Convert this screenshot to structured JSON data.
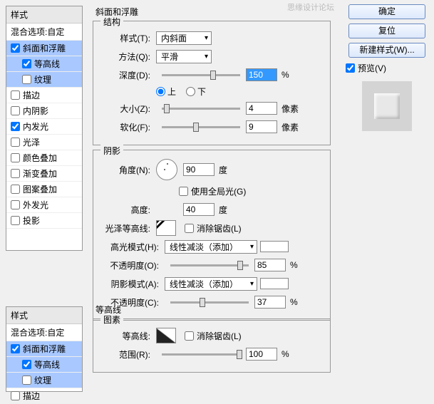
{
  "watermark": "思缘设计论坛",
  "styles_panel": {
    "header": "样式",
    "blend": "混合选项:自定",
    "items": [
      {
        "label": "斜面和浮雕",
        "checked": true,
        "selected": true
      },
      {
        "label": "等高线",
        "checked": true,
        "sub": true,
        "selected": true
      },
      {
        "label": "纹理",
        "checked": false,
        "sub": true,
        "selected": true
      },
      {
        "label": "描边",
        "checked": false
      },
      {
        "label": "内阴影",
        "checked": false
      },
      {
        "label": "内发光",
        "checked": true
      },
      {
        "label": "光泽",
        "checked": false
      },
      {
        "label": "颜色叠加",
        "checked": false
      },
      {
        "label": "渐变叠加",
        "checked": false
      },
      {
        "label": "图案叠加",
        "checked": false
      },
      {
        "label": "外发光",
        "checked": false
      },
      {
        "label": "投影",
        "checked": false
      }
    ]
  },
  "bottom_styles": {
    "header": "样式",
    "blend": "混合选项:自定",
    "items": [
      {
        "label": "斜面和浮雕",
        "checked": true,
        "selected": true
      },
      {
        "label": "等高线",
        "checked": true,
        "sub": true,
        "selected": true
      },
      {
        "label": "纹理",
        "checked": false,
        "sub": true,
        "selected": true
      },
      {
        "label": "描边",
        "checked": false
      }
    ]
  },
  "bevel": {
    "title": "斜面和浮雕",
    "structure_label": "结构",
    "style_label": "样式(T):",
    "style_value": "内斜面",
    "method_label": "方法(Q):",
    "method_value": "平滑",
    "depth_label": "深度(D):",
    "depth_value": "150",
    "depth_unit": "%",
    "direction_up": "上",
    "direction_down": "下",
    "size_label": "大小(Z):",
    "size_value": "4",
    "size_unit": "像素",
    "soften_label": "软化(F):",
    "soften_value": "9",
    "soften_unit": "像素"
  },
  "shadow": {
    "label": "阴影",
    "angle_label": "角度(N):",
    "angle_value": "90",
    "angle_unit": "度",
    "global_label": "使用全局光(G)",
    "altitude_label": "高度:",
    "altitude_value": "40",
    "altitude_unit": "度",
    "gloss_label": "光泽等高线:",
    "antialias_label": "消除锯齿(L)",
    "highlight_mode_label": "高光模式(H):",
    "highlight_mode_value": "线性减淡（添加）",
    "highlight_opacity_label": "不透明度(O):",
    "highlight_opacity_value": "85",
    "highlight_opacity_unit": "%",
    "shadow_mode_label": "阴影模式(A):",
    "shadow_mode_value": "线性减淡（添加）",
    "shadow_opacity_label": "不透明度(C):",
    "shadow_opacity_value": "37",
    "shadow_opacity_unit": "%"
  },
  "contour": {
    "title": "等高线",
    "elements_label": "图素",
    "contour_label": "等高线:",
    "antialias_label": "消除锯齿(L)",
    "range_label": "范围(R):",
    "range_value": "100",
    "range_unit": "%"
  },
  "buttons": {
    "ok": "确定",
    "reset": "复位",
    "new_style": "新建样式(W)...",
    "preview": "预览(V)"
  }
}
